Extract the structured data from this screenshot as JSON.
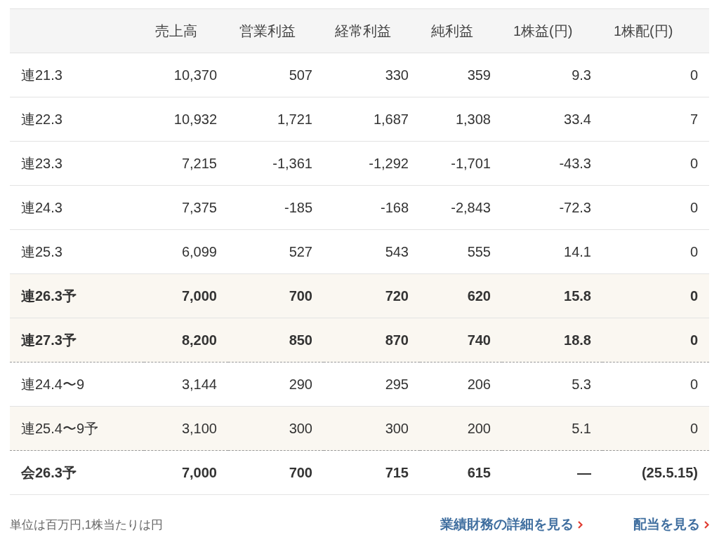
{
  "columns": [
    "売上高",
    "営業利益",
    "経常利益",
    "純利益",
    "1株益(円)",
    "1株配(円)"
  ],
  "groups": [
    {
      "rows": [
        {
          "period": "連21.3",
          "values": [
            "10,370",
            "507",
            "330",
            "359",
            "9.3",
            "0"
          ],
          "bold": false,
          "forecast": false
        },
        {
          "period": "連22.3",
          "values": [
            "10,932",
            "1,721",
            "1,687",
            "1,308",
            "33.4",
            "7"
          ],
          "bold": false,
          "forecast": false
        },
        {
          "period": "連23.3",
          "values": [
            "7,215",
            "-1,361",
            "-1,292",
            "-1,701",
            "-43.3",
            "0"
          ],
          "bold": false,
          "forecast": false
        },
        {
          "period": "連24.3",
          "values": [
            "7,375",
            "-185",
            "-168",
            "-2,843",
            "-72.3",
            "0"
          ],
          "bold": false,
          "forecast": false
        },
        {
          "period": "連25.3",
          "values": [
            "6,099",
            "527",
            "543",
            "555",
            "14.1",
            "0"
          ],
          "bold": false,
          "forecast": false
        },
        {
          "period": "連26.3予",
          "values": [
            "7,000",
            "700",
            "720",
            "620",
            "15.8",
            "0"
          ],
          "bold": true,
          "forecast": true
        },
        {
          "period": "連27.3予",
          "values": [
            "8,200",
            "850",
            "870",
            "740",
            "18.8",
            "0"
          ],
          "bold": true,
          "forecast": true
        }
      ]
    },
    {
      "rows": [
        {
          "period": "連24.4〜9",
          "values": [
            "3,144",
            "290",
            "295",
            "206",
            "5.3",
            "0"
          ],
          "bold": false,
          "forecast": false
        },
        {
          "period": "連25.4〜9予",
          "values": [
            "3,100",
            "300",
            "300",
            "200",
            "5.1",
            "0"
          ],
          "bold": false,
          "forecast": true
        }
      ]
    },
    {
      "rows": [
        {
          "period": "会26.3予",
          "values": [
            "7,000",
            "700",
            "715",
            "615",
            "—",
            "(25.5.15)"
          ],
          "bold": true,
          "forecast": false
        }
      ]
    }
  ],
  "footer": {
    "note": "単位は百万円,1株当たりは円",
    "links": [
      "業績財務の詳細を見る",
      "配当を見る"
    ]
  }
}
